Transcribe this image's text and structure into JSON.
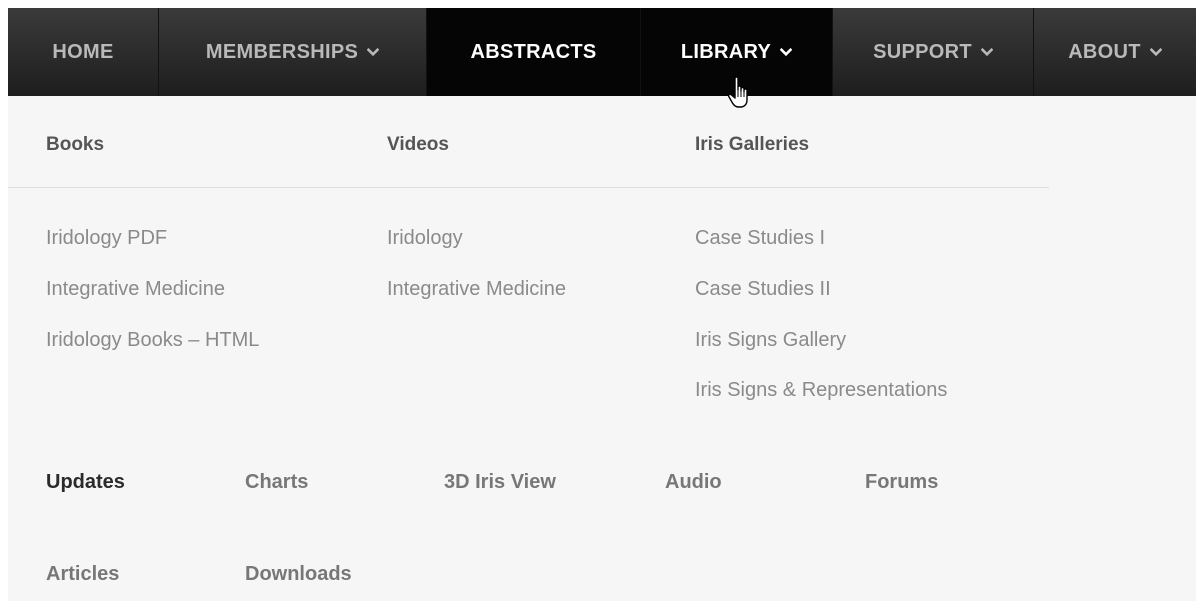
{
  "nav": {
    "items": [
      {
        "label": "HOME",
        "has_dropdown": false
      },
      {
        "label": "MEMBERSHIPS",
        "has_dropdown": true
      },
      {
        "label": "ABSTRACTS",
        "has_dropdown": false
      },
      {
        "label": "LIBRARY",
        "has_dropdown": true
      },
      {
        "label": "SUPPORT",
        "has_dropdown": true
      },
      {
        "label": "ABOUT",
        "has_dropdown": true
      }
    ]
  },
  "dropdown": {
    "books": {
      "heading": "Books",
      "links": [
        "Iridology PDF",
        "Integrative Medicine",
        "Iridology Books – HTML"
      ]
    },
    "videos": {
      "heading": "Videos",
      "links": [
        "Iridology",
        "Integrative Medicine"
      ]
    },
    "iris_galleries": {
      "heading": "Iris Galleries",
      "links": [
        "Case Studies I",
        "Case Studies II",
        "Iris Signs Gallery",
        "Iris Signs & Representations"
      ]
    },
    "bottom_links": {
      "updates": "Updates",
      "charts": "Charts",
      "iris_3d": "3D Iris View",
      "audio": "Audio",
      "forums": "Forums",
      "articles": "Articles",
      "downloads": "Downloads"
    }
  },
  "colors": {
    "nav_bg": "#2c2c2c",
    "nav_active_bg": "#050505",
    "nav_text": "#b9b9b9",
    "nav_active_text": "#ffffff",
    "panel_bg": "#f6f6f6",
    "heading_text": "#555555",
    "link_text": "#8a8a8a"
  },
  "icons": {
    "chevron": "chevron-down-icon",
    "cursor": "hand-pointer-icon"
  }
}
